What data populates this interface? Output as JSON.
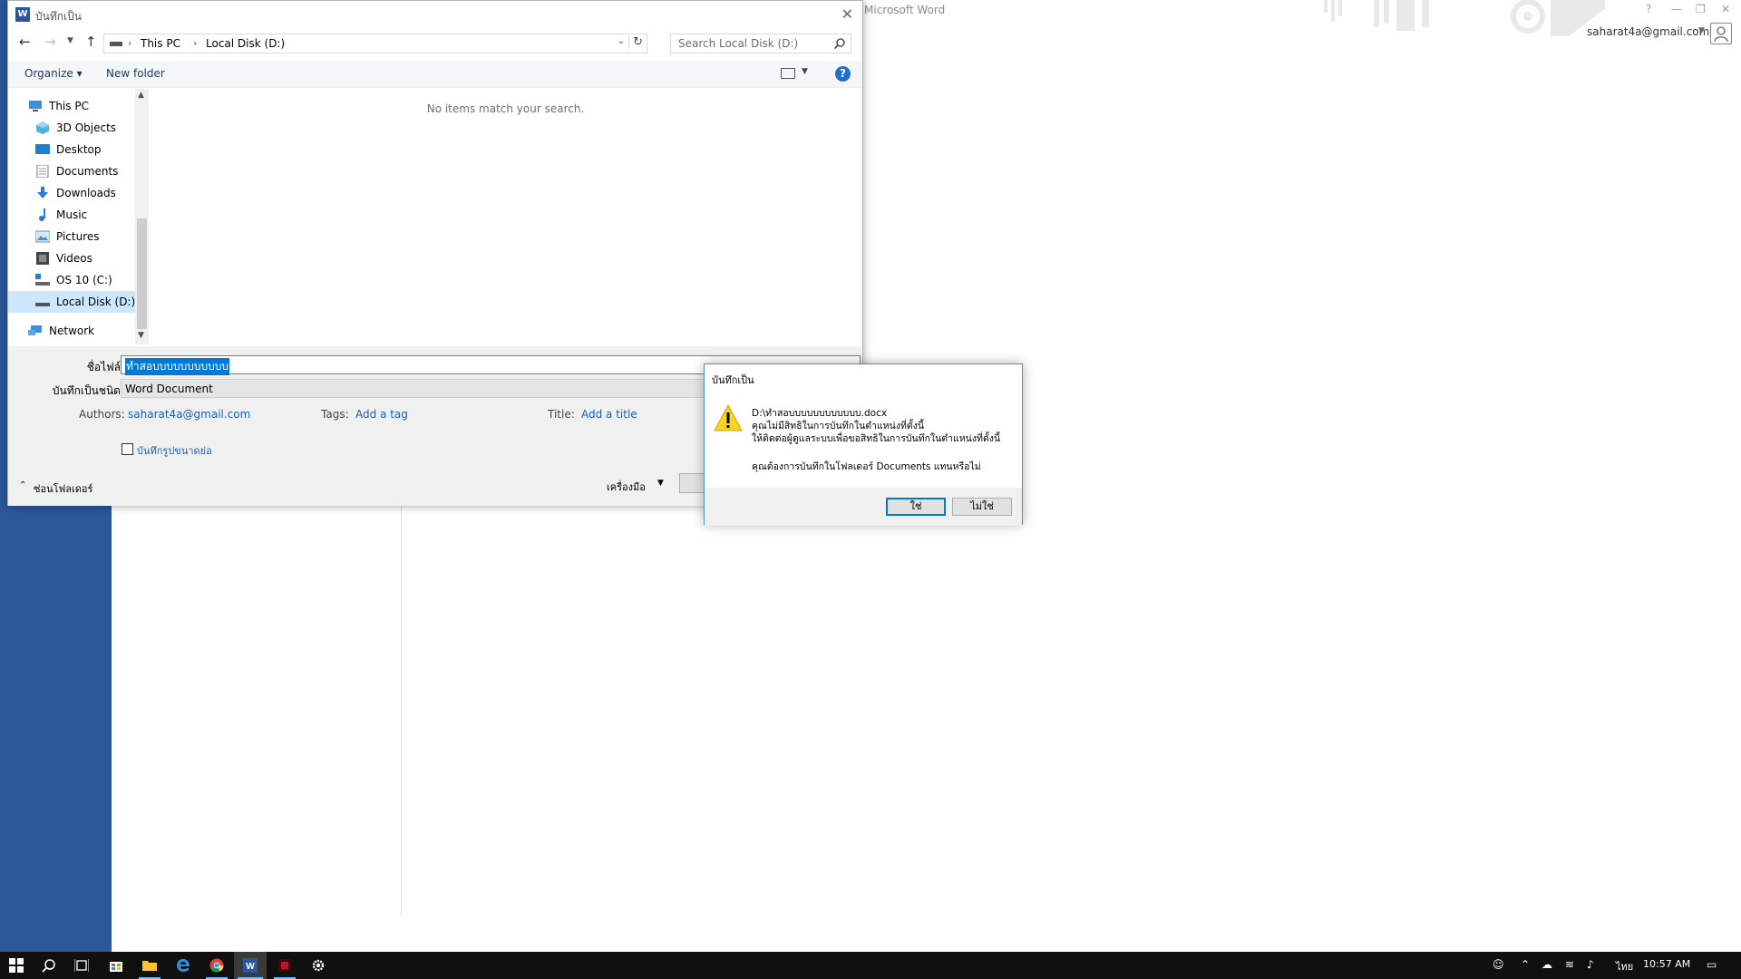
{
  "word": {
    "app_title": "Microsoft Word",
    "user_email": "saharat4a@gmail.com",
    "help_label": "?",
    "restore_label": "❐",
    "close_label": "✕"
  },
  "saveas": {
    "title": "บันทึกเป็น",
    "address": {
      "this_pc": "This PC",
      "local_disk": "Local Disk (D:)"
    },
    "search_placeholder": "Search Local Disk (D:)",
    "toolbar": {
      "organize": "Organize ▾",
      "new_folder": "New folder",
      "help": "?"
    },
    "nav_items": [
      {
        "label": "This PC",
        "icon": "computer-icon"
      },
      {
        "label": "3D Objects",
        "icon": "cube-icon"
      },
      {
        "label": "Desktop",
        "icon": "desktop-icon"
      },
      {
        "label": "Documents",
        "icon": "document-icon"
      },
      {
        "label": "Downloads",
        "icon": "download-icon"
      },
      {
        "label": "Music",
        "icon": "music-icon"
      },
      {
        "label": "Pictures",
        "icon": "picture-icon"
      },
      {
        "label": "Videos",
        "icon": "video-icon"
      },
      {
        "label": "OS 10 (C:)",
        "icon": "drive-c-icon"
      },
      {
        "label": "Local Disk (D:)",
        "icon": "drive-icon"
      },
      {
        "label": "Network",
        "icon": "network-icon"
      }
    ],
    "empty_message": "No items match your search.",
    "filename_label": "ชื่อไฟล์:",
    "filename_value": "ทำสอบบบบบบบบบบบ",
    "savetype_label": "บันทึกเป็นชนิด:",
    "savetype_value": "Word Document",
    "authors_label": "Authors:",
    "authors_value": "saharat4a@gmail.com",
    "tags_label": "Tags:",
    "tags_value": "Add a tag",
    "title_label": "Title:",
    "title_value": "Add a title",
    "thumbnail_label": "บันทึกรูปขนาดย่อ",
    "hide_folders_label": "ซ่อนโฟลเดอร์",
    "tools_label": "เครื่องมือ"
  },
  "alert": {
    "title": "บันทึกเป็น",
    "lines": [
      "D:\\ทำสอบบบบบบบบบบบบ.docx",
      "คุณไม่มีสิทธิในการบันทึกในตำแหน่งที่ตั้งนี้",
      "ให้ติดต่อผู้ดูแลระบบเพื่อขอสิทธิในการบันทึกในตำแหน่งที่ตั้งนี้",
      "คุณต้องการบันทึกในโฟลเดอร์ Documents แทนหรือไม่"
    ],
    "yes_label": "ใช่",
    "no_label": "ไม่ใช่"
  },
  "taskbar": {
    "apps": [
      "start-icon",
      "search-icon",
      "task-view-icon",
      "store-icon",
      "file-explorer-icon",
      "edge-icon",
      "chrome-icon",
      "word-icon",
      "media-app-icon",
      "settings-icon"
    ],
    "language": "ไทย",
    "time": "10:57 AM"
  },
  "colors": {
    "word_blue": "#2b579a",
    "accent": "#0078d7",
    "taskbar": "#101010"
  }
}
